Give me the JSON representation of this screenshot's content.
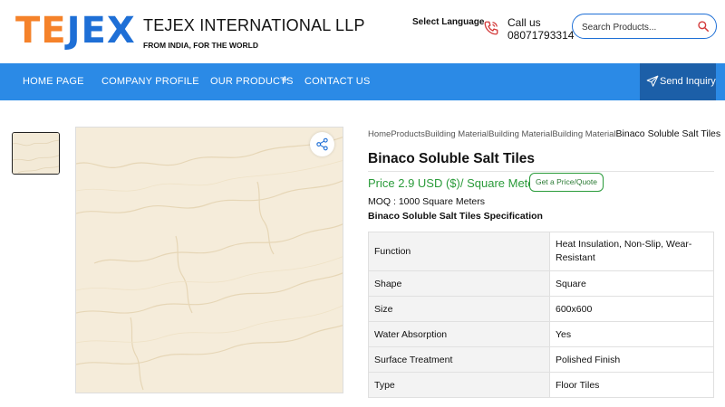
{
  "header": {
    "logo": {
      "part1": "TE",
      "part2": "JEX"
    },
    "company_name": "TEJEX INTERNATIONAL LLP",
    "tagline": "FROM INDIA, FOR THE WORLD",
    "language_label": "Select Language",
    "call_label": "Call us",
    "phone": "08071793314",
    "search_placeholder": "Search Products..."
  },
  "nav": {
    "items": [
      "HOME PAGE",
      "COMPANY PROFILE",
      "OUR PRODUCTS",
      "CONTACT US"
    ],
    "expand_symbol": "+",
    "inquiry_label": "Send Inquiry"
  },
  "product": {
    "breadcrumbs": [
      "Home",
      "Products",
      "Building Material",
      "Building Material",
      "Building Material"
    ],
    "breadcrumb_current": "Binaco Soluble Salt Tiles",
    "title": "Binaco Soluble Salt Tiles",
    "price": "Price 2.9 USD ($)/ Square Meter",
    "quote_button": "Get a Price/Quote",
    "moq": "MOQ : 1000 Square Meters",
    "spec_title": "Binaco Soluble Salt Tiles Specification",
    "specs": [
      {
        "key": "Function",
        "value": "Heat Insulation, Non-Slip, Wear-Resistant"
      },
      {
        "key": "Shape",
        "value": "Square"
      },
      {
        "key": "Size",
        "value": "600x600"
      },
      {
        "key": "Water Absorption",
        "value": "Yes"
      },
      {
        "key": "Surface Treatment",
        "value": "Polished Finish"
      },
      {
        "key": "Type",
        "value": "Floor Tiles"
      }
    ]
  },
  "icons": {
    "phone": "phone-icon",
    "search": "search-icon",
    "send": "paper-plane-icon",
    "share": "share-icon"
  },
  "colors": {
    "nav_bg": "#2b8ae6",
    "inquiry_bg": "#1c5fa8",
    "price_green": "#2a9b3a",
    "logo_orange": "#f5822a",
    "logo_blue": "#1e6fd6"
  }
}
